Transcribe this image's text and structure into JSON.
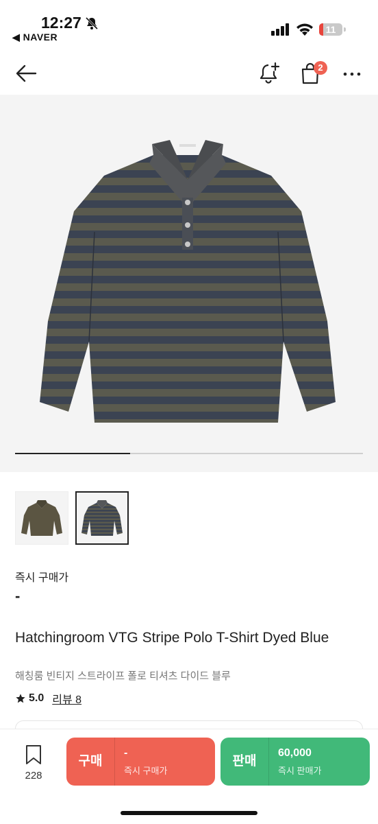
{
  "status": {
    "time": "12:27",
    "back_app": "◀ NAVER",
    "battery": "11"
  },
  "nav": {
    "cart_count": "2",
    "icons": [
      "arrow-left-icon",
      "bell-plus-icon",
      "shopping-bag-icon",
      "more-icon"
    ]
  },
  "gallery": {
    "progress_fraction": 0.33,
    "thumbnails": [
      "olive-polo",
      "navy-stripe-polo"
    ],
    "selected_index": 1
  },
  "price": {
    "label": "즉시 구매가",
    "value": "-"
  },
  "product": {
    "title": "Hatchingroom VTG Stripe Polo T-Shirt Dyed Blue",
    "subtitle": "해칭룸 빈티지 스트라이프 폴로 티셔츠 다이드 블루",
    "rating": "5.0",
    "review_label": "리뷰 8"
  },
  "bottom": {
    "wish_count": "228",
    "buy": {
      "label": "구매",
      "price": "-",
      "sub": "즉시 구매가"
    },
    "sell": {
      "label": "판매",
      "price": "60,000",
      "sub": "즉시 판매가"
    }
  },
  "colors": {
    "buy": "#ef6253",
    "sell": "#41b979",
    "badge": "#ef6253"
  }
}
